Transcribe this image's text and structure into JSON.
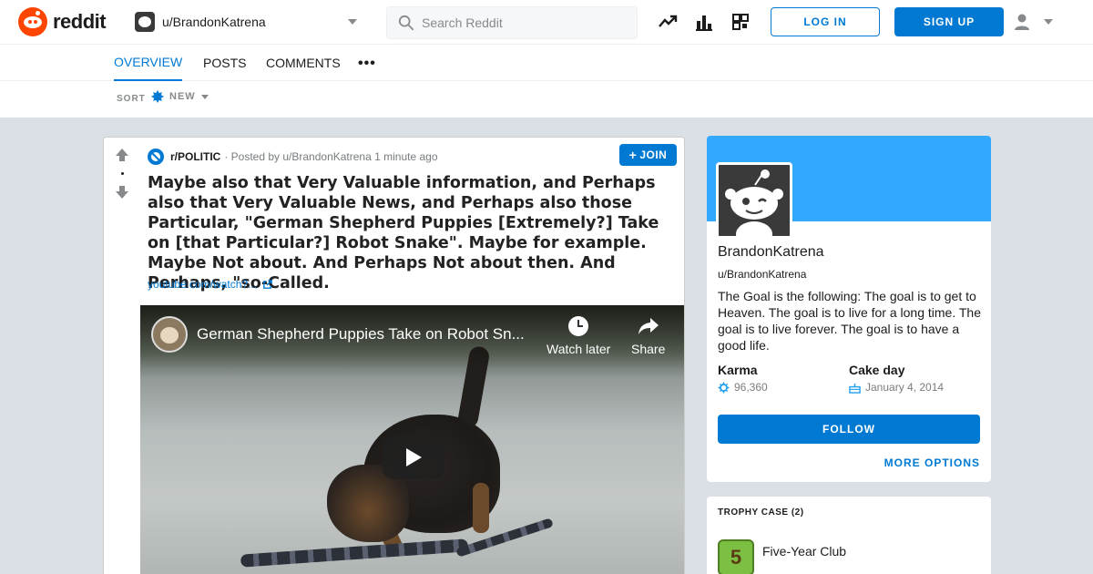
{
  "header": {
    "logo_text": "reddit",
    "user_dropdown": "u/BrandonKatrena",
    "search_placeholder": "Search Reddit",
    "login_label": "LOG IN",
    "signup_label": "SIGN UP"
  },
  "tabs": [
    {
      "label": "OVERVIEW",
      "active": true
    },
    {
      "label": "POSTS",
      "active": false
    },
    {
      "label": "COMMENTS",
      "active": false
    }
  ],
  "tab_more": "•••",
  "sort": {
    "label": "SORT",
    "value": "NEW"
  },
  "post": {
    "subreddit": "r/POLITIC",
    "posted_by": "· Posted by u/BrandonKatrena 1 minute ago",
    "join_label": "JOIN",
    "title": "Maybe also that Very Valuable information, and Perhaps also that Very Valuable News, and Perhaps also those Particular, \"German Shepherd Puppies [Extremely?] Take on [that Particular?] Robot Snake\". Maybe for example. Maybe Not about. And Perhaps Not about then. And Perhaps, \"so-Called.",
    "link": "youtube.com/watch?...",
    "video": {
      "title": "German Shepherd Puppies Take on Robot Sn...",
      "watch_later": "Watch later",
      "share": "Share"
    }
  },
  "profile": {
    "display_name": "BrandonKatrena",
    "username": "u/BrandonKatrena",
    "bio": "The Goal is the following: The goal is to get to Heaven. The goal is to live for a long time. The goal is to live forever. The goal is to have a good life.",
    "karma_label": "Karma",
    "karma_value": "96,360",
    "cake_label": "Cake day",
    "cake_value": "January 4, 2014",
    "follow_label": "FOLLOW",
    "more_options": "MORE OPTIONS"
  },
  "trophy_case": {
    "title": "TROPHY CASE (2)",
    "items": [
      {
        "name": "Five-Year Club",
        "badge": "5"
      }
    ]
  },
  "colors": {
    "brand": "#ff4500",
    "accent": "#0079d3",
    "banner": "#33a8ff"
  }
}
